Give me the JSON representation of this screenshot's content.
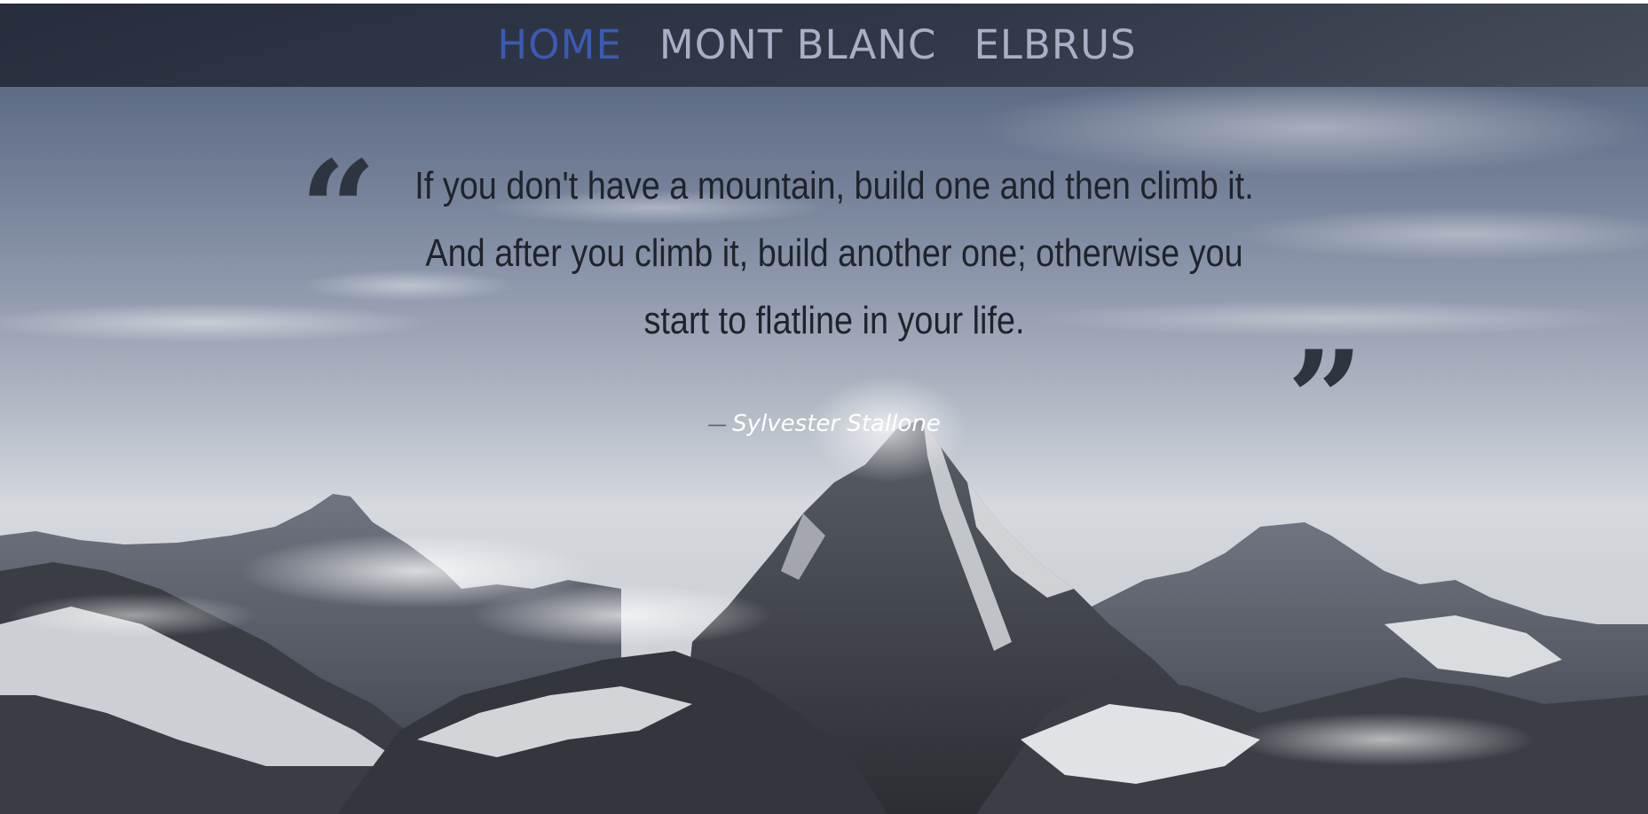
{
  "nav": {
    "items": [
      {
        "label": "HOME",
        "active": true
      },
      {
        "label": "MONT BLANC",
        "active": false
      },
      {
        "label": "ELBRUS",
        "active": false
      }
    ],
    "active_color": "#3a5ab4",
    "inactive_color": "#a7b0c4"
  },
  "quote": {
    "open_mark": "“",
    "close_mark": "”",
    "lines": [
      "If you don't have a mountain, build one and then climb it.",
      "And after you climb it, build another one; otherwise you",
      "start to flatline in your life."
    ],
    "author_dash": "—",
    "author": "Sylvester Stallone"
  },
  "background": {
    "description_icon": "mountain-landscape"
  }
}
